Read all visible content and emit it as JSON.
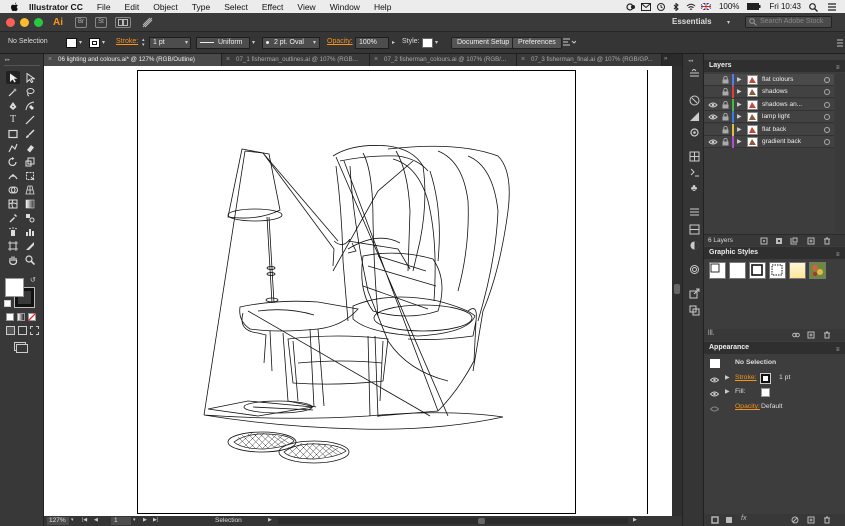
{
  "menubar": {
    "app_name": "Illustrator CC",
    "items": [
      "File",
      "Edit",
      "Object",
      "Type",
      "Select",
      "Effect",
      "View",
      "Window",
      "Help"
    ],
    "battery": "100%",
    "clock": "Fri 10:43"
  },
  "appbar": {
    "logo": "Ai",
    "btn_br": "Br",
    "btn_st": "St",
    "workspace": "Essentials",
    "search_placeholder": "Search Adobe Stock"
  },
  "control": {
    "selection": "No Selection",
    "stroke_label": "Stroke:",
    "stroke_value": "1 pt",
    "profile": "Uniform",
    "brush": "2 pt. Oval",
    "opacity_label": "Opacity:",
    "opacity_value": "100%",
    "style_label": "Style:",
    "doc_setup": "Document Setup",
    "preferences": "Preferences"
  },
  "tabs": [
    {
      "label": "06 lighting and colours.ai* @ 127% (RGB/Outline)",
      "active": true
    },
    {
      "label": "07_1 fisherman_outlines.ai @ 107% (RGB...",
      "active": false
    },
    {
      "label": "07_2 fisherman_colours.ai @ 107% (RGB/...",
      "active": false
    },
    {
      "label": "07_3 fisherman_final.ai @ 107% (RGB/GP...",
      "active": false
    }
  ],
  "status": {
    "zoom": "127%",
    "page": "1",
    "tool": "Selection"
  },
  "layers": {
    "title": "Layers",
    "count": "6 Layers",
    "items": [
      {
        "name": "flat colours",
        "visible": false,
        "color": "#4f7df0",
        "selected": true
      },
      {
        "name": "shadows",
        "visible": false,
        "color": "#e03c3c",
        "selected": false
      },
      {
        "name": "shadows an...",
        "visible": true,
        "color": "#3fbf3f",
        "selected": false
      },
      {
        "name": "lamp light",
        "visible": true,
        "color": "#3a7de0",
        "selected": false
      },
      {
        "name": "flat back",
        "visible": false,
        "color": "#e0c03a",
        "selected": false
      },
      {
        "name": "gradient back",
        "visible": true,
        "color": "#b04fd0",
        "selected": false
      }
    ]
  },
  "graphic_styles": {
    "title": "Graphic Styles"
  },
  "appearance": {
    "title": "Appearance",
    "selection": "No Selection",
    "stroke_label": "Stroke:",
    "stroke_value": "1 pt",
    "fill_label": "Fill:",
    "opacity_label": "Opacity:",
    "opacity_value": "Default"
  }
}
